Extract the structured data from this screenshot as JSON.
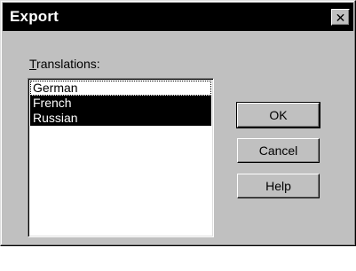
{
  "dialog": {
    "title": "Export",
    "close_glyph": "✕"
  },
  "translations": {
    "label_first": "T",
    "label_rest": "ranslations:",
    "items": [
      {
        "label": "German",
        "selected": false
      },
      {
        "label": "French",
        "selected": true
      },
      {
        "label": "Russian",
        "selected": true
      }
    ]
  },
  "buttons": {
    "ok": "OK",
    "cancel": "Cancel",
    "help": "Help"
  },
  "colors": {
    "face": "#c0c0c0",
    "titlebar": "#000000",
    "selection": "#000000"
  }
}
